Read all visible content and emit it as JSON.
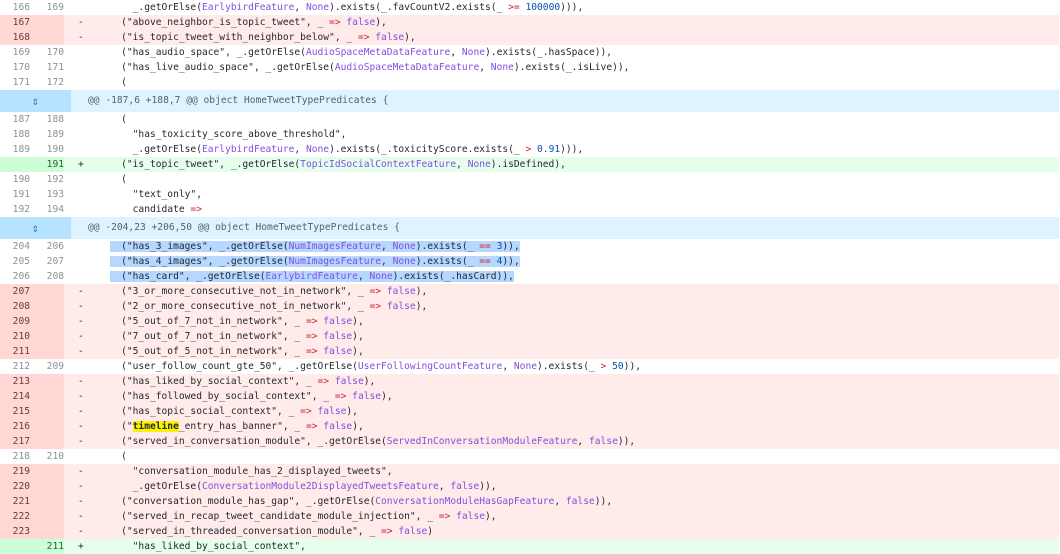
{
  "diff": {
    "rows": [
      {
        "type": "ctx",
        "old": "166",
        "new": "169",
        "marker": "",
        "code": "      _.getOrElse(EarlybirdFeature, None).exists(_.favCountV2.exists(_ >= 100000))),"
      },
      {
        "type": "del",
        "old": "167",
        "new": "",
        "marker": "-",
        "code": "    (\"above_neighbor_is_topic_tweet\", _ => false),"
      },
      {
        "type": "del",
        "old": "168",
        "new": "",
        "marker": "-",
        "code": "    (\"is_topic_tweet_with_neighbor_below\", _ => false),"
      },
      {
        "type": "ctx",
        "old": "169",
        "new": "170",
        "marker": "",
        "code": "    (\"has_audio_space\", _.getOrElse(AudioSpaceMetaDataFeature, None).exists(_.hasSpace)),"
      },
      {
        "type": "ctx",
        "old": "170",
        "new": "171",
        "marker": "",
        "code": "    (\"has_live_audio_space\", _.getOrElse(AudioSpaceMetaDataFeature, None).exists(_.isLive)),"
      },
      {
        "type": "ctx",
        "old": "171",
        "new": "172",
        "marker": "",
        "code": "    ("
      },
      {
        "type": "hunk",
        "text": "@@ -187,6 +188,7 @@ object HomeTweetTypePredicates {"
      },
      {
        "type": "ctx",
        "old": "187",
        "new": "188",
        "marker": "",
        "code": "    ("
      },
      {
        "type": "ctx",
        "old": "188",
        "new": "189",
        "marker": "",
        "code": "      \"has_toxicity_score_above_threshold\","
      },
      {
        "type": "ctx",
        "old": "189",
        "new": "190",
        "marker": "",
        "code": "      _.getOrElse(EarlybirdFeature, None).exists(_.toxicityScore.exists(_ > 0.91))),"
      },
      {
        "type": "add",
        "old": "",
        "new": "191",
        "marker": "+",
        "code": "    (\"is_topic_tweet\", _.getOrElse(TopicIdSocialContextFeature, None).isDefined),"
      },
      {
        "type": "ctx",
        "old": "190",
        "new": "192",
        "marker": "",
        "code": "    ("
      },
      {
        "type": "ctx",
        "old": "191",
        "new": "193",
        "marker": "",
        "code": "      \"text_only\","
      },
      {
        "type": "ctx",
        "old": "192",
        "new": "194",
        "marker": "",
        "code": "      candidate =>"
      },
      {
        "type": "hunk",
        "text": "@@ -204,23 +206,50 @@ object HomeTweetTypePredicates {"
      },
      {
        "type": "ctx",
        "old": "204",
        "new": "206",
        "marker": "",
        "code": "    (\"has_3_images\", _.getOrElse(NumImagesFeature, None).exists(_ == 3)),"
      },
      {
        "type": "ctx",
        "old": "205",
        "new": "207",
        "marker": "",
        "code": "    (\"has_4_images\", _.getOrElse(NumImagesFeature, None).exists(_ == 4)),"
      },
      {
        "type": "ctx",
        "old": "206",
        "new": "208",
        "marker": "",
        "code": "    (\"has_card\", _.getOrElse(EarlybirdFeature, None).exists(_.hasCard)),"
      },
      {
        "type": "del",
        "old": "207",
        "new": "",
        "marker": "-",
        "code": "    (\"3_or_more_consecutive_not_in_network\", _ => false),"
      },
      {
        "type": "del",
        "old": "208",
        "new": "",
        "marker": "-",
        "code": "    (\"2_or_more_consecutive_not_in_network\", _ => false),"
      },
      {
        "type": "del",
        "old": "209",
        "new": "",
        "marker": "-",
        "code": "    (\"5_out_of_7_not_in_network\", _ => false),"
      },
      {
        "type": "del",
        "old": "210",
        "new": "",
        "marker": "-",
        "code": "    (\"7_out_of_7_not_in_network\", _ => false),"
      },
      {
        "type": "del",
        "old": "211",
        "new": "",
        "marker": "-",
        "code": "    (\"5_out_of_5_not_in_network\", _ => false),"
      },
      {
        "type": "ctx",
        "old": "212",
        "new": "209",
        "marker": "",
        "code": "    (\"user_follow_count_gte_50\", _.getOrElse(UserFollowingCountFeature, None).exists(_ > 50)),"
      },
      {
        "type": "del",
        "old": "213",
        "new": "",
        "marker": "-",
        "code": "    (\"has_liked_by_social_context\", _ => false),"
      },
      {
        "type": "del",
        "old": "214",
        "new": "",
        "marker": "-",
        "code": "    (\"has_followed_by_social_context\", _ => false),"
      },
      {
        "type": "del",
        "old": "215",
        "new": "",
        "marker": "-",
        "code": "    (\"has_topic_social_context\", _ => false),"
      },
      {
        "type": "del",
        "old": "216",
        "new": "",
        "marker": "-",
        "code": "    (\"timeline_entry_has_banner\", _ => false),"
      },
      {
        "type": "del",
        "old": "217",
        "new": "",
        "marker": "-",
        "code": "    (\"served_in_conversation_module\", _.getOrElse(ServedInConversationModuleFeature, false)),"
      },
      {
        "type": "ctx",
        "old": "218",
        "new": "210",
        "marker": "",
        "code": "    ("
      },
      {
        "type": "del",
        "old": "219",
        "new": "",
        "marker": "-",
        "code": "      \"conversation_module_has_2_displayed_tweets\","
      },
      {
        "type": "del",
        "old": "220",
        "new": "",
        "marker": "-",
        "code": "      _.getOrElse(ConversationModule2DisplayedTweetsFeature, false)),"
      },
      {
        "type": "del",
        "old": "221",
        "new": "",
        "marker": "-",
        "code": "    (\"conversation_module_has_gap\", _.getOrElse(ConversationModuleHasGapFeature, false)),"
      },
      {
        "type": "del",
        "old": "222",
        "new": "",
        "marker": "-",
        "code": "    (\"served_in_recap_tweet_candidate_module_injection\", _ => false),"
      },
      {
        "type": "del",
        "old": "223",
        "new": "",
        "marker": "-",
        "code": "    (\"served_in_threaded_conversation_module\", _ => false)"
      },
      {
        "type": "add",
        "old": "",
        "new": "211",
        "marker": "+",
        "code": "      \"has_liked_by_social_context\","
      }
    ]
  },
  "search_highlight": "timeline",
  "expand_icon": "expand-icon"
}
